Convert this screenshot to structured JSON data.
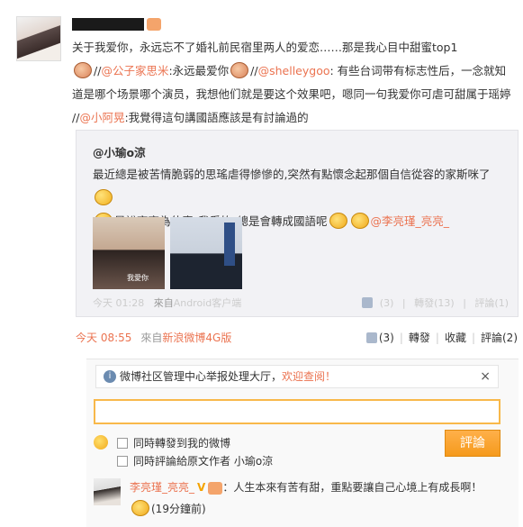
{
  "post": {
    "text_line1": "关于我爱你，永远忘不了婚礼前民宿里两人的爱恋……那是我心目中甜蜜top1",
    "mention1": "@公子家思米",
    "text_after_m1": ":永远最爱你",
    "mention2": "@shelleygoo",
    "text_after_m2": ": 有些台词带有标志性后，一念就知道是哪个场景哪个演员，我想他们就是要这个效果吧，嗯同一句我爱你可虐可甜属于瑶婷 //",
    "mention3": "@小阿晃",
    "text_after_m3": ":我覺得這句講國語應該是有討論過的"
  },
  "repost": {
    "user": "@小瑜o涼",
    "text1": "最近總是被苦情脆弱的思瑤虐得慘慘的,突然有點懷念起那個自信從容的家斯咪了",
    "text2": "是說亮亮為什麼\"我愛妳\"總是會轉成國語呢",
    "mention": "@李亮瑾_亮亮_",
    "thumb_caption": "我愛你",
    "time": "今天 01:28",
    "source_prefix": "來自",
    "source": "Android客户端",
    "likes": "(3)",
    "reposts": "轉發(13)",
    "comments": "評論(1)"
  },
  "meta": {
    "time": "今天 08:55",
    "source_prefix": "來自",
    "source": "新浪微博4G版",
    "likes": "(3)",
    "repost": "轉發",
    "favorite": "收藏",
    "comment": "評論(2)"
  },
  "comment_box": {
    "notice_text": "微博社区管理中心举报处理大厅，",
    "notice_link": "欢迎查阅！",
    "close": "×",
    "check1": "同時轉發到我的微博",
    "check2": "同時評論給原文作者 小瑜o涼",
    "submit": "評論"
  },
  "reply": {
    "user": "李亮瑾_亮亮_",
    "v": "V",
    "text": "：人生本來有苦有甜，重點要讓自己心境上有成長啊！",
    "time": "(19分鐘前)"
  }
}
